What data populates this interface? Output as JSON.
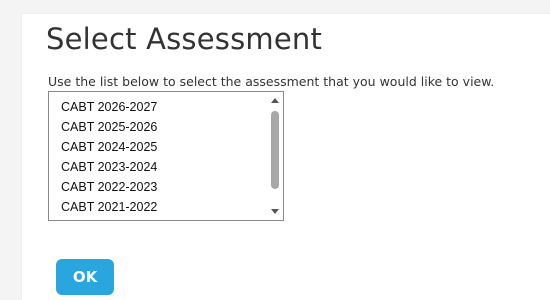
{
  "page": {
    "title": "Select Assessment",
    "instructions": "Use the list below to select the assessment that you would like to view."
  },
  "assessment_list": {
    "options": [
      {
        "label": "CABT 2026-2027"
      },
      {
        "label": "CABT 2025-2026"
      },
      {
        "label": "CABT 2024-2025"
      },
      {
        "label": "CABT 2023-2024"
      },
      {
        "label": "CABT 2022-2023"
      },
      {
        "label": "CABT 2021-2022"
      }
    ],
    "scroll_icons": {
      "up": "scroll-up-arrow-icon",
      "down": "scroll-down-arrow-icon"
    }
  },
  "actions": {
    "ok_label": "OK"
  },
  "colors": {
    "ok_button": "#2aa6df",
    "title_text": "#333333",
    "scroll_thumb": "#a8a8a8"
  }
}
